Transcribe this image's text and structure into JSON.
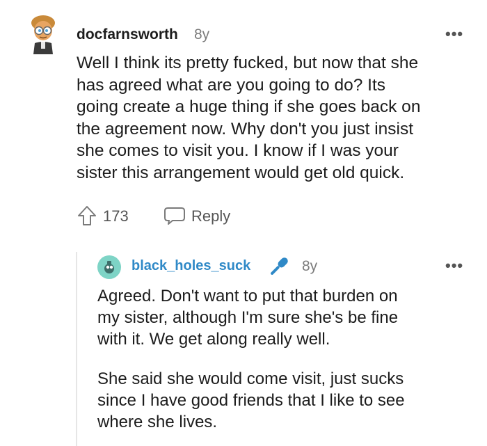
{
  "comment": {
    "avatar": "avatar-icon",
    "username": "docfarnsworth",
    "age": "8y",
    "more": "•••",
    "body": [
      "Well I think its pretty fucked, but now that she",
      "has agreed what are you going to do? Its",
      "going create a huge thing if she goes back on",
      "the agreement now. Why don't you just insist",
      "she comes to visit you. I know if I was your",
      "sister this arrangement would get old quick."
    ],
    "upvote_icon": "upvote-icon",
    "score": "173",
    "reply_icon": "reply-bubble-icon",
    "reply_label": "Reply"
  },
  "reply": {
    "avatar": "avatar-icon",
    "username": "black_holes_suck",
    "badge_icon": "microphone-icon",
    "age": "8y",
    "more": "•••",
    "paragraph1": [
      "Agreed. Don't want to put that burden on",
      "my sister, although I'm sure she's be fine",
      "with it. We get along really well."
    ],
    "paragraph2": [
      "She said she would come visit, just sucks",
      "since I have good friends that I like to see",
      "where she lives."
    ]
  },
  "colors": {
    "text": "#1c1c1c",
    "meta": "#7c7c7c",
    "reply_username": "#2f89c7",
    "thread_line": "#e6e6e6"
  }
}
